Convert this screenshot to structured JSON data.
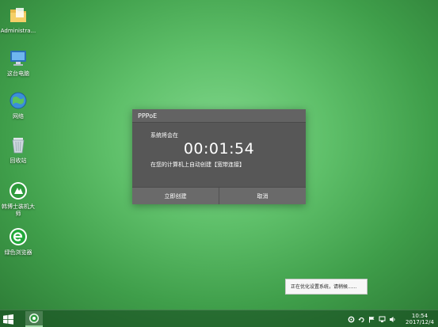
{
  "desktop": {
    "icons": [
      {
        "label": "Administra...",
        "icon": "folder-icon"
      },
      {
        "label": "这台电脑",
        "icon": "computer-icon"
      },
      {
        "label": "网络",
        "icon": "network-icon"
      },
      {
        "label": "回收站",
        "icon": "recycle-bin-icon"
      },
      {
        "label": "韩博士装机大师",
        "icon": "installer-app-icon"
      },
      {
        "label": "绿色浏览器",
        "icon": "browser-icon"
      }
    ]
  },
  "dialog": {
    "title": "PPPoE",
    "message_line1": "系统将会在",
    "countdown": "00:01:54",
    "message_line2": "在您的计算机上自动创建【宽带连接】",
    "confirm_label": "立即创建",
    "cancel_label": "取消"
  },
  "toast": {
    "text": "正在优化设置系统，请稍候......"
  },
  "taskbar": {
    "time": "10:54",
    "date": "2017/12/4"
  },
  "colors": {
    "dialog_bg": "#575757",
    "dialog_button": "#6a6a6a",
    "desktop_green": "#5fc06a"
  }
}
